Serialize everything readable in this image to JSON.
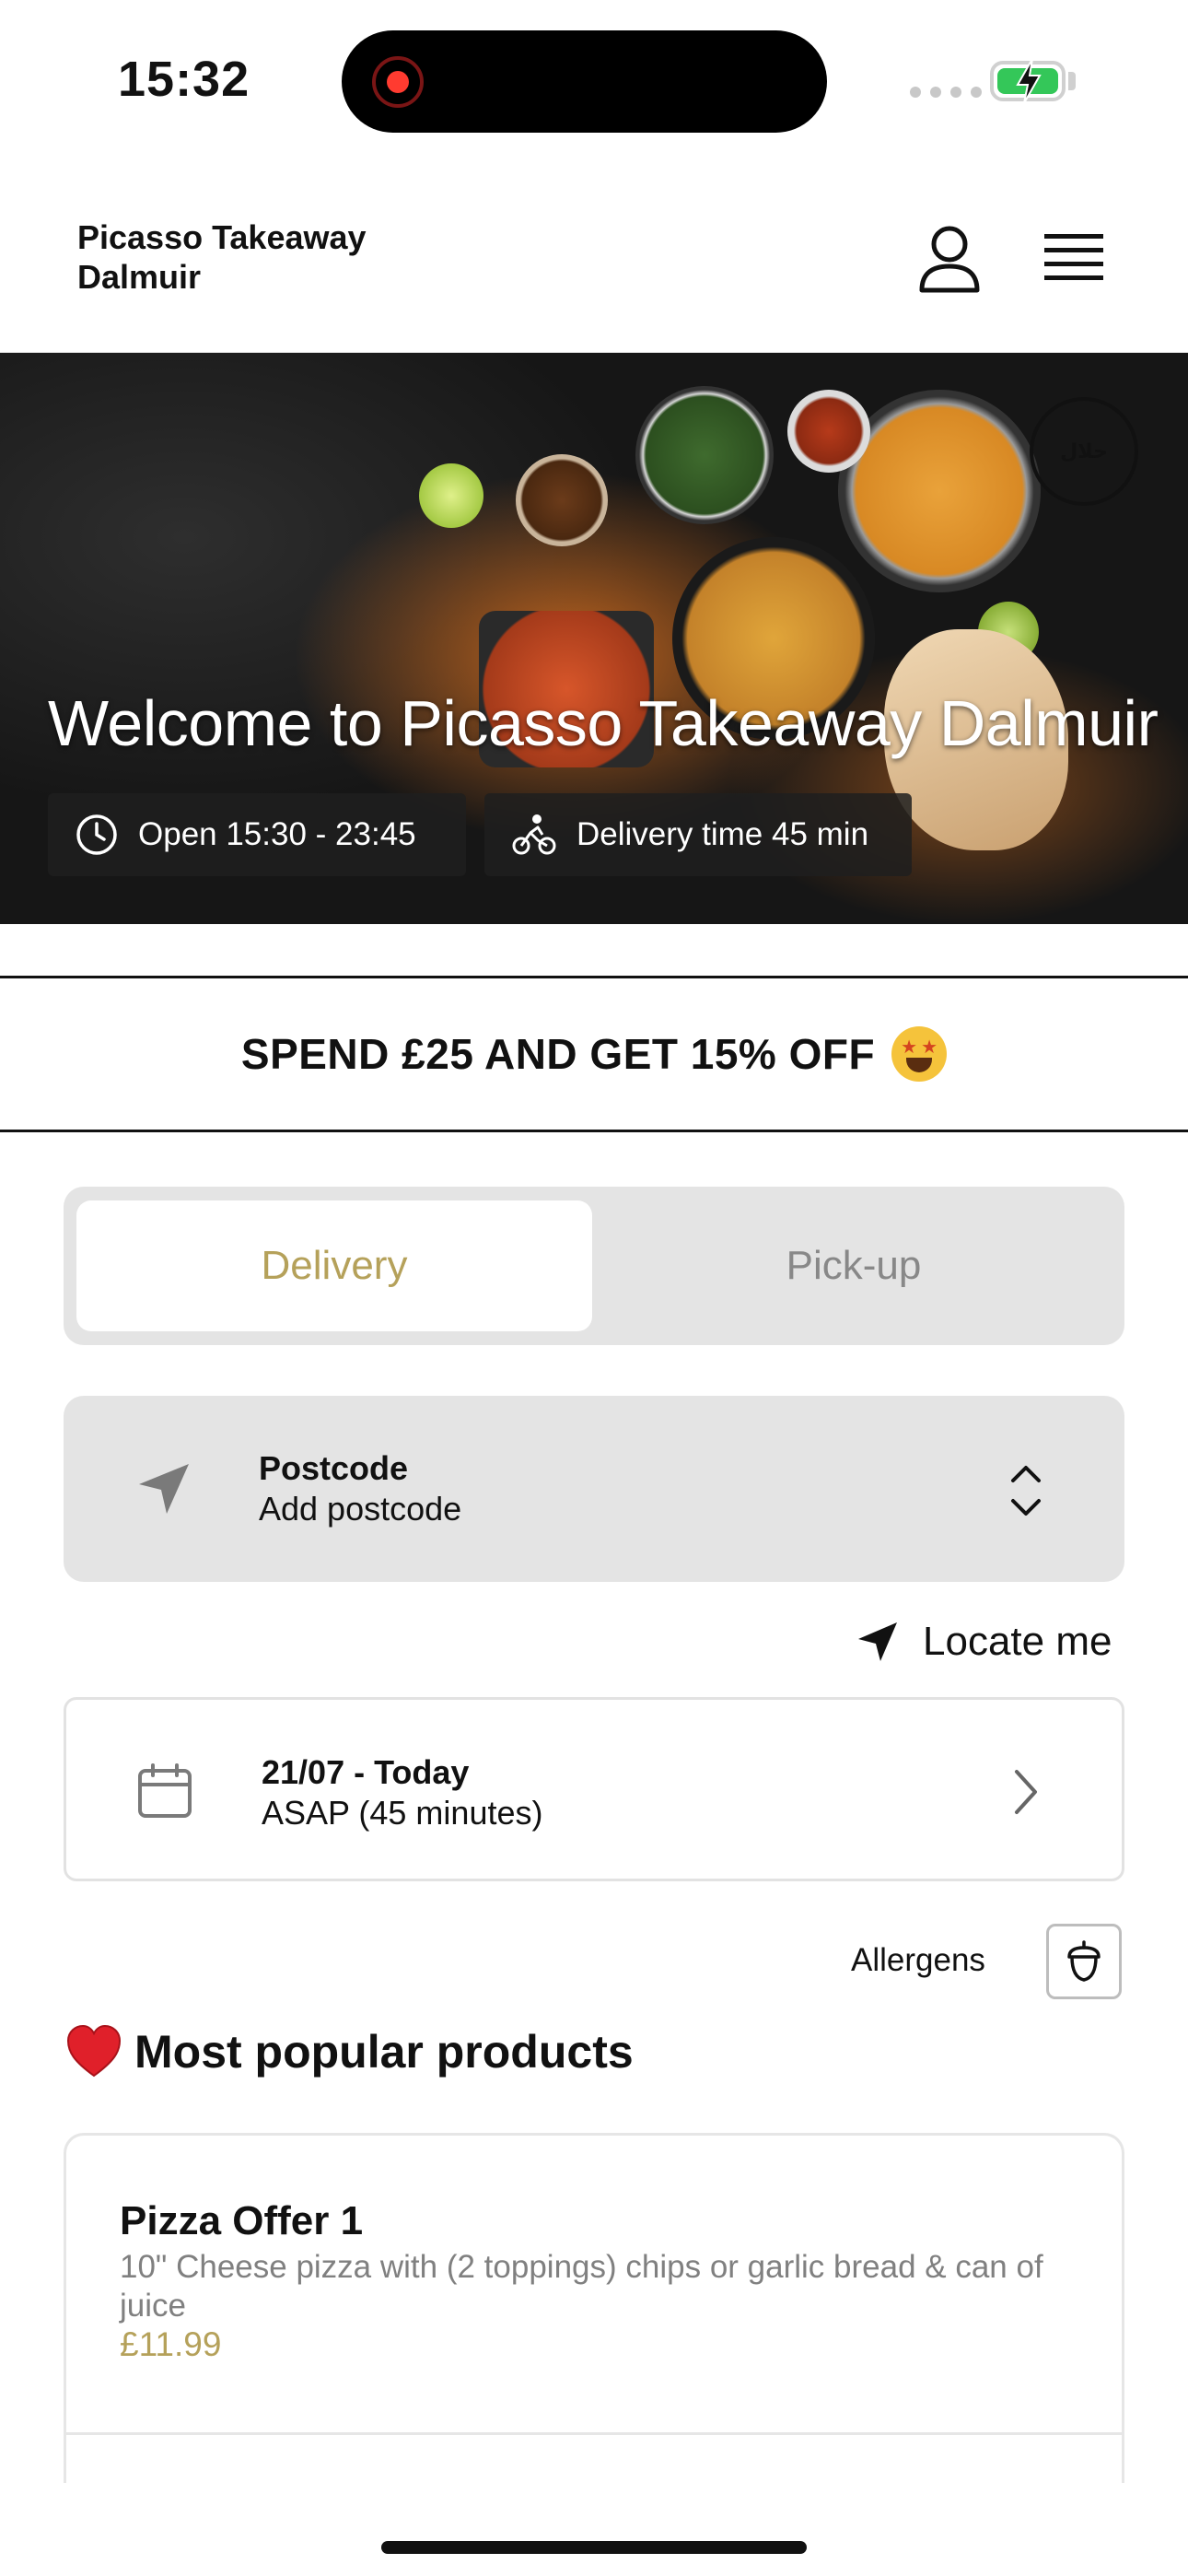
{
  "status": {
    "time": "15:32"
  },
  "header": {
    "brand": "Picasso Takeaway Dalmuir"
  },
  "hero": {
    "title": "Welcome to Picasso Takeaway Dalmuir",
    "open_hours": "Open 15:30 - 23:45",
    "delivery_time": "Delivery time 45 min"
  },
  "promo": {
    "text": "SPEND £25 AND GET 15% OFF"
  },
  "order_mode": {
    "options": [
      "Delivery",
      "Pick-up"
    ],
    "selected": "Delivery"
  },
  "postcode": {
    "label": "Postcode",
    "value": "Add postcode"
  },
  "locate": {
    "label": "Locate me"
  },
  "schedule": {
    "date": "21/07 - Today",
    "time": "ASAP (45 minutes)"
  },
  "allergens": {
    "label": "Allergens"
  },
  "popular": {
    "title": "Most popular products",
    "products": [
      {
        "name": "Pizza Offer 1",
        "description": "10\" Cheese pizza with (2 toppings) chips or garlic bread & can of juice",
        "price": "£11.99"
      }
    ]
  },
  "colors": {
    "accent": "#b5a15a",
    "battery": "#34c759",
    "panel": "#e4e4e4"
  },
  "icons": [
    "user-icon",
    "menu-icon",
    "clock-icon",
    "bike-icon",
    "location-arrow-icon",
    "chevron-updown-icon",
    "calendar-icon",
    "chevron-right-icon",
    "acorn-icon",
    "heart-icon"
  ]
}
